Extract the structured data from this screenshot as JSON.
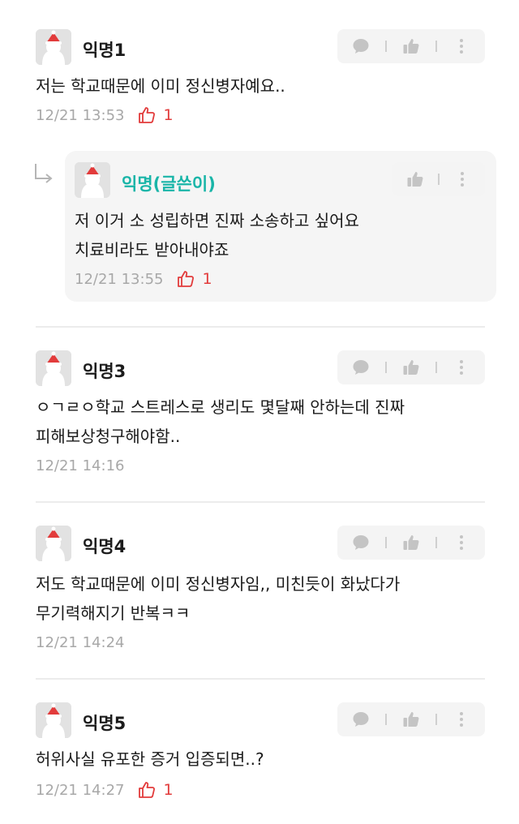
{
  "comments": [
    {
      "name": "익명1",
      "lines": [
        "저는 학교때문에 이미 정신병자예요.."
      ],
      "time": "12/21 13:53",
      "likes": "1"
    },
    {
      "name": "익명(글쓴이)",
      "lines": [
        "저 이거 소 성립하면 진짜 소송하고 싶어요",
        "치료비라도 받아내야죠"
      ],
      "time": "12/21 13:55",
      "likes": "1",
      "is_reply": true
    },
    {
      "name": "익명3",
      "lines": [
        "ㅇㄱㄹㅇ학교 스트레스로 생리도 몇달째 안하는데 진짜",
        "피해보상청구해야함.."
      ],
      "time": "12/21 14:16"
    },
    {
      "name": "익명4",
      "lines": [
        "저도 학교때문에 이미 정신병자임,, 미친듯이 화났다가",
        "무기력해지기 반복ㅋㅋ"
      ],
      "time": "12/21 14:24"
    },
    {
      "name": "익명5",
      "lines": [
        "허위사실 유포한 증거 입증되면..?"
      ],
      "time": "12/21 14:27",
      "likes": "1"
    }
  ],
  "icons": {
    "avatar": "anonymous-santa-avatar",
    "reply": "speech-bubble-icon",
    "like": "thumbs-up-icon",
    "more": "more-vertical-icon",
    "reply_indicator": "reply-arrow-icon"
  },
  "colors": {
    "writer_name": "#19b5a8",
    "like_red": "#e23b3b",
    "meta_gray": "#a8a8a8"
  }
}
